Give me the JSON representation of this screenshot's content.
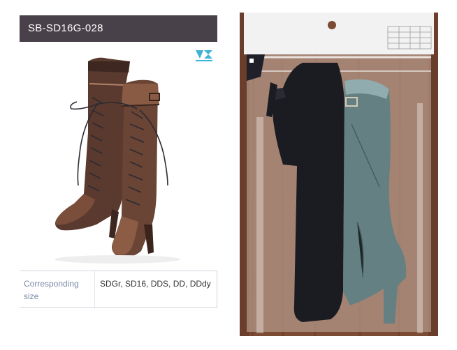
{
  "product": {
    "code": "SB-SD16G-028",
    "brand_logo": "volks-vs-logo",
    "spec_label": "Corresponding size",
    "spec_value": "SDGr, SD16, DDS, DD, DDdy"
  },
  "images": {
    "product_photo": "brown lace-up knee-high boots with heels and buckle strap",
    "package_photo": "dark boots sealed inside clear plastic bag with hanger header on wooden background"
  },
  "colors": {
    "title_bar": "#494149",
    "label_text": "#7a8aa7",
    "logo": "#3fb3d6"
  }
}
